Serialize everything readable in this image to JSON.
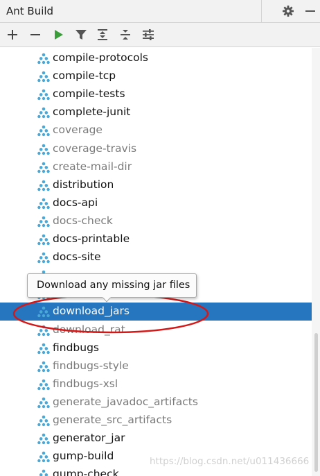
{
  "window": {
    "title": "Ant Build"
  },
  "title_actions": [
    {
      "name": "gear-icon"
    },
    {
      "name": "minimize-icon"
    }
  ],
  "toolbar": {
    "buttons": [
      {
        "name": "add-icon"
      },
      {
        "name": "remove-icon"
      },
      {
        "name": "run-icon"
      },
      {
        "name": "filter-icon"
      },
      {
        "name": "expand-all-icon"
      },
      {
        "name": "collapse-all-icon"
      },
      {
        "name": "properties-icon"
      }
    ]
  },
  "colors": {
    "selection": "#2675bf",
    "ant_icon": "#4aa8d6",
    "run_icon": "#3a9d3a",
    "annotation": "#d41818"
  },
  "targets": [
    {
      "label": "compile-protocols",
      "muted": false
    },
    {
      "label": "compile-tcp",
      "muted": false
    },
    {
      "label": "compile-tests",
      "muted": false
    },
    {
      "label": "complete-junit",
      "muted": false
    },
    {
      "label": "coverage",
      "muted": true
    },
    {
      "label": "coverage-travis",
      "muted": true
    },
    {
      "label": "create-mail-dir",
      "muted": true
    },
    {
      "label": "distribution",
      "muted": false
    },
    {
      "label": "docs-api",
      "muted": false
    },
    {
      "label": "docs-check",
      "muted": true
    },
    {
      "label": "docs-printable",
      "muted": false
    },
    {
      "label": "docs-site",
      "muted": false
    },
    {
      "label": "",
      "muted": false
    },
    {
      "label": "",
      "muted": false
    },
    {
      "label": "download_jars",
      "muted": false,
      "selected": true
    },
    {
      "label": "download_rat",
      "muted": true
    },
    {
      "label": "findbugs",
      "muted": false
    },
    {
      "label": "findbugs-style",
      "muted": true
    },
    {
      "label": "findbugs-xsl",
      "muted": true
    },
    {
      "label": "generate_javadoc_artifacts",
      "muted": true
    },
    {
      "label": "generate_src_artifacts",
      "muted": true
    },
    {
      "label": "generator_jar",
      "muted": false
    },
    {
      "label": "gump-build",
      "muted": false
    },
    {
      "label": "gump-check",
      "muted": false
    }
  ],
  "tooltip": {
    "text": "Download any missing jar files"
  },
  "watermark": {
    "text": "https://blog.csdn.net/u011436666"
  }
}
